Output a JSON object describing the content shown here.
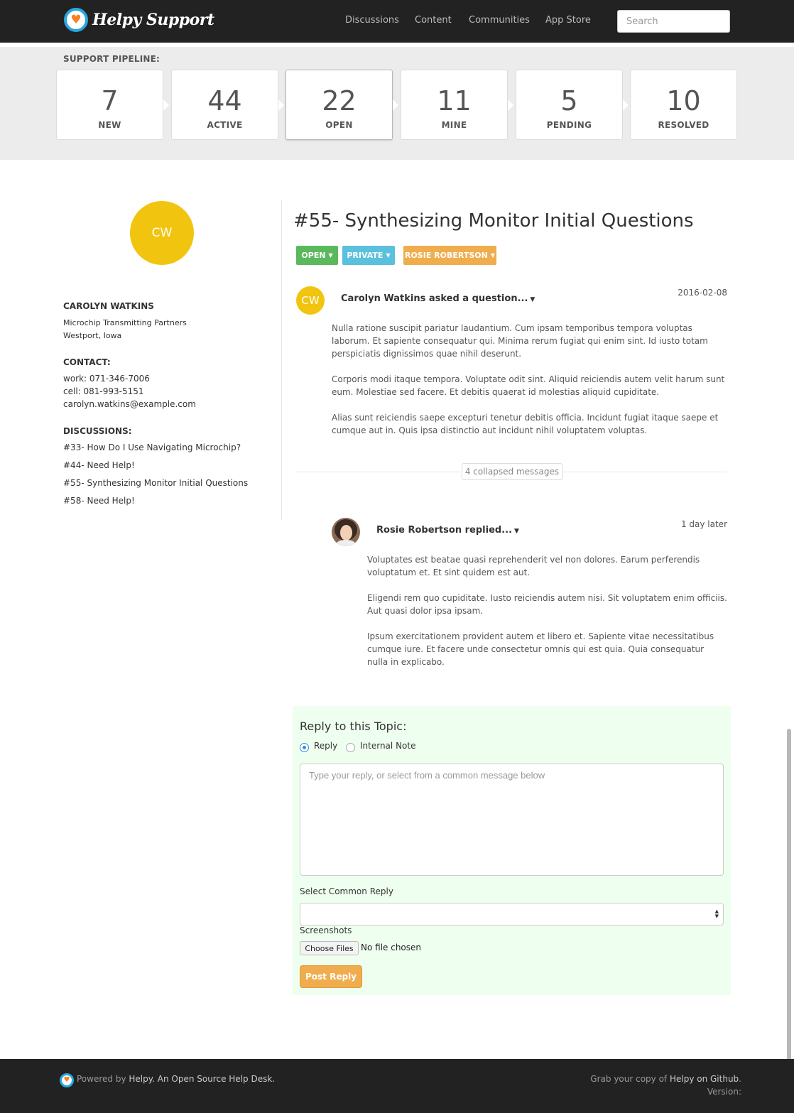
{
  "header": {
    "brand": "Helpy Support",
    "nav": [
      "Discussions",
      "Content",
      "Communities",
      "App Store"
    ],
    "search_placeholder": "Search"
  },
  "pipeline": {
    "label": "SUPPORT PIPELINE:",
    "stats": [
      {
        "count": "7",
        "label": "NEW"
      },
      {
        "count": "44",
        "label": "ACTIVE"
      },
      {
        "count": "22",
        "label": "OPEN"
      },
      {
        "count": "11",
        "label": "MINE"
      },
      {
        "count": "5",
        "label": "PENDING"
      },
      {
        "count": "10",
        "label": "RESOLVED"
      }
    ]
  },
  "customer": {
    "initials": "CW",
    "name": "CAROLYN WATKINS",
    "company": "Microchip Transmitting Partners",
    "location": "Westport, Iowa",
    "contact_heading": "CONTACT:",
    "work": "work: 071-346-7006",
    "cell": "cell: 081-993-5151",
    "email": "carolyn.watkins@example.com",
    "discussions_heading": "DISCUSSIONS:",
    "discussions": [
      "#33- How Do I Use Navigating Microchip?",
      "#44- Need Help!",
      "#55- Synthesizing Monitor Initial Questions",
      "#58- Need Help!"
    ]
  },
  "ticket": {
    "title": "#55- Synthesizing Monitor Initial Questions",
    "status": "OPEN",
    "visibility": "PRIVATE",
    "assignee": "ROSIE ROBERTSON"
  },
  "messages": [
    {
      "initials": "CW",
      "author": "Carolyn Watkins asked a question...",
      "date": "2016-02-08",
      "paragraphs": [
        "Nulla ratione suscipit pariatur laudantium. Cum ipsam temporibus tempora voluptas laborum. Et sapiente consequatur qui. Minima rerum fugiat qui enim sint. Id iusto totam perspiciatis dignissimos quae nihil deserunt.",
        "Corporis modi itaque tempora. Voluptate odit sint. Aliquid reiciendis autem velit harum sunt eum. Molestiae sed facere. Et debitis quaerat id molestias aliquid cupiditate.",
        "Alias sunt reiciendis saepe excepturi tenetur debitis officia. Incidunt fugiat itaque saepe et cumque aut in. Quis ipsa distinctio aut incidunt nihil voluptatem voluptas."
      ]
    },
    {
      "author": "Rosie Robertson replied...",
      "date": "1 day later",
      "paragraphs": [
        "Voluptates est beatae quasi reprehenderit vel non dolores. Earum perferendis voluptatum et. Et sint quidem est aut.",
        "Eligendi rem quo cupiditate. Iusto reiciendis autem nisi. Sit voluptatem enim officiis. Aut quasi dolor ipsa ipsam.",
        "Ipsum exercitationem provident autem et libero et. Sapiente vitae necessitatibus cumque iure. Et facere unde consectetur omnis qui est quia. Quia consequatur nulla in explicabo."
      ]
    }
  ],
  "collapsed_label": "4 collapsed messages",
  "reply": {
    "title": "Reply to this Topic:",
    "option_reply": "Reply",
    "option_note": "Internal Note",
    "selected_option": "Reply",
    "placeholder": "Type your reply, or select from a common message below",
    "common_reply_label": "Select Common Reply",
    "common_reply_value": "",
    "screenshots_label": "Screenshots",
    "choose_files": "Choose Files",
    "file_status": "No file chosen",
    "submit": "Post Reply"
  },
  "footer": {
    "powered_prefix": "Powered by ",
    "powered_link": "Helpy. An Open Source Help Desk.",
    "grab_prefix": "Grab your copy of ",
    "grab_link": "Helpy on Github",
    "grab_suffix": ".",
    "version": "Version:"
  },
  "colors": {
    "header_bg": "#222222",
    "avatar_yellow": "#f1c40f",
    "open_green": "#5cb85c",
    "private_blue": "#5bc0de",
    "assignee_orange": "#f0ad4e",
    "reply_panel_bg": "#efffef"
  },
  "icons": [
    "helpy-logo-icon",
    "caret-down-icon",
    "radio-icon",
    "select-arrows-icon"
  ]
}
